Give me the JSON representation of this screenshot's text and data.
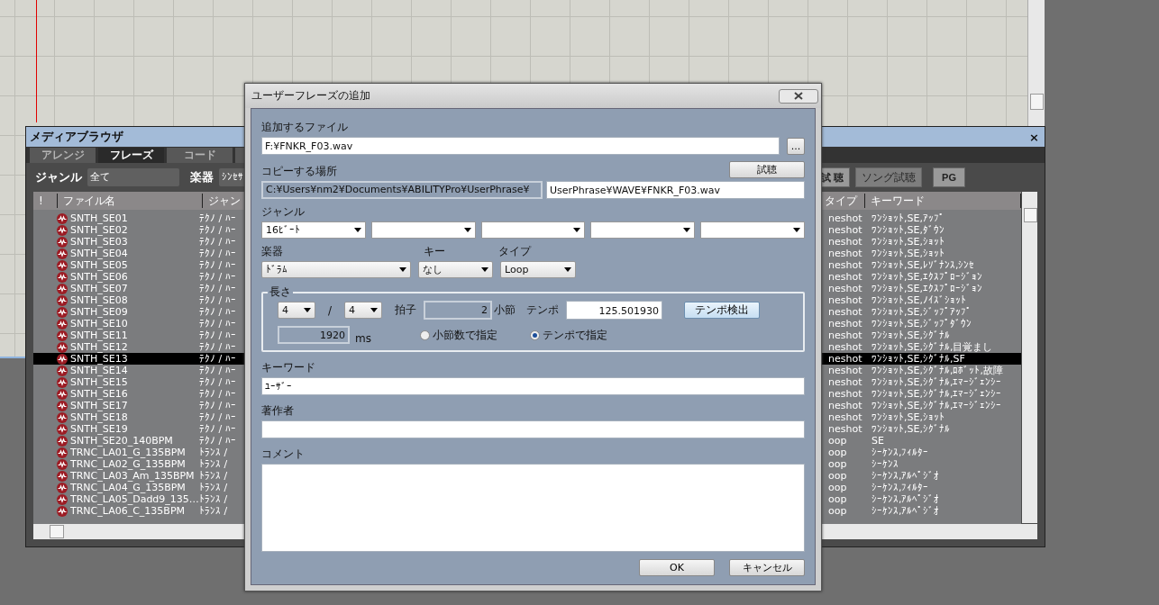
{
  "media_browser": {
    "title": "メディアブラウザ",
    "close": "×",
    "tabs": [
      {
        "label": "アレンジ",
        "selected": false
      },
      {
        "label": "フレーズ",
        "selected": true
      },
      {
        "label": "コード",
        "selected": false
      },
      {
        "selected": false
      }
    ],
    "genre_label": "ジャンル",
    "genre_value": "全て",
    "instrument_label": "楽器",
    "instrument_value": "ｼﾝｾｻ",
    "buttons": [
      {
        "label": "試 聴",
        "disabled": false
      },
      {
        "label": "ソング試聴",
        "disabled": true
      },
      {
        "label": "PG",
        "disabled": false
      }
    ],
    "columns": [
      "!",
      "ファイル名",
      "ジャン",
      "タイプ",
      "キーワード"
    ],
    "rows": [
      {
        "name": "SNTH_SE01",
        "genre": "ﾃｸﾉ / ﾊｰ",
        "type": "neshot",
        "keyword": "ﾜﾝｼｮｯﾄ,SE,ｱｯﾌﾟ",
        "selected": false
      },
      {
        "name": "SNTH_SE02",
        "genre": "ﾃｸﾉ / ﾊｰ",
        "type": "neshot",
        "keyword": "ﾜﾝｼｮｯﾄ,SE,ﾀﾞｳﾝ",
        "selected": false
      },
      {
        "name": "SNTH_SE03",
        "genre": "ﾃｸﾉ / ﾊｰ",
        "type": "neshot",
        "keyword": "ﾜﾝｼｮｯﾄ,SE,ｼｮｯﾄ",
        "selected": false
      },
      {
        "name": "SNTH_SE04",
        "genre": "ﾃｸﾉ / ﾊｰ",
        "type": "neshot",
        "keyword": "ﾜﾝｼｮｯﾄ,SE,ｼｮｯﾄ",
        "selected": false
      },
      {
        "name": "SNTH_SE05",
        "genre": "ﾃｸﾉ / ﾊｰ",
        "type": "neshot",
        "keyword": "ﾜﾝｼｮｯﾄ,SE,ﾚｿﾞﾅﾝｽ,ｼﾝｾ",
        "selected": false
      },
      {
        "name": "SNTH_SE06",
        "genre": "ﾃｸﾉ / ﾊｰ",
        "type": "neshot",
        "keyword": "ﾜﾝｼｮｯﾄ,SE,ｴｸｽﾌﾟﾛｰｼﾞｮﾝ",
        "selected": false
      },
      {
        "name": "SNTH_SE07",
        "genre": "ﾃｸﾉ / ﾊｰ",
        "type": "neshot",
        "keyword": "ﾜﾝｼｮｯﾄ,SE,ｴｸｽﾌﾟﾛｰｼﾞｮﾝ",
        "selected": false
      },
      {
        "name": "SNTH_SE08",
        "genre": "ﾃｸﾉ / ﾊｰ",
        "type": "neshot",
        "keyword": "ﾜﾝｼｮｯﾄ,SE,ﾉｲｽﾞｼｮｯﾄ",
        "selected": false
      },
      {
        "name": "SNTH_SE09",
        "genre": "ﾃｸﾉ / ﾊｰ",
        "type": "neshot",
        "keyword": "ﾜﾝｼｮｯﾄ,SE,ｼﾞｯﾌﾟｱｯﾌﾟ",
        "selected": false
      },
      {
        "name": "SNTH_SE10",
        "genre": "ﾃｸﾉ / ﾊｰ",
        "type": "neshot",
        "keyword": "ﾜﾝｼｮｯﾄ,SE,ｼﾞｯﾌﾟﾀﾞｳﾝ",
        "selected": false
      },
      {
        "name": "SNTH_SE11",
        "genre": "ﾃｸﾉ / ﾊｰ",
        "type": "neshot",
        "keyword": "ﾜﾝｼｮｯﾄ,SE,ｼｸﾞﾅﾙ",
        "selected": false
      },
      {
        "name": "SNTH_SE12",
        "genre": "ﾃｸﾉ / ﾊｰ",
        "type": "neshot",
        "keyword": "ﾜﾝｼｮｯﾄ,SE,ｼｸﾞﾅﾙ,目覚まし",
        "selected": false
      },
      {
        "name": "SNTH_SE13",
        "genre": "ﾃｸﾉ / ﾊｰ",
        "type": "neshot",
        "keyword": "ﾜﾝｼｮｯﾄ,SE,ｼｸﾞﾅﾙ,SF",
        "selected": true
      },
      {
        "name": "SNTH_SE14",
        "genre": "ﾃｸﾉ / ﾊｰ",
        "type": "neshot",
        "keyword": "ﾜﾝｼｮｯﾄ,SE,ｼｸﾞﾅﾙ,ﾛﾎﾞｯﾄ,故障",
        "selected": false
      },
      {
        "name": "SNTH_SE15",
        "genre": "ﾃｸﾉ / ﾊｰ",
        "type": "neshot",
        "keyword": "ﾜﾝｼｮｯﾄ,SE,ｼｸﾞﾅﾙ,ｴﾏｰｼﾞｪﾝｼｰ",
        "selected": false
      },
      {
        "name": "SNTH_SE16",
        "genre": "ﾃｸﾉ / ﾊｰ",
        "type": "neshot",
        "keyword": "ﾜﾝｼｮｯﾄ,SE,ｼｸﾞﾅﾙ,ｴﾏｰｼﾞｪﾝｼｰ",
        "selected": false
      },
      {
        "name": "SNTH_SE17",
        "genre": "ﾃｸﾉ / ﾊｰ",
        "type": "neshot",
        "keyword": "ﾜﾝｼｮｯﾄ,SE,ｼｸﾞﾅﾙ,ｴﾏｰｼﾞｪﾝｼｰ",
        "selected": false
      },
      {
        "name": "SNTH_SE18",
        "genre": "ﾃｸﾉ / ﾊｰ",
        "type": "neshot",
        "keyword": "ﾜﾝｼｮｯﾄ,SE,ｼｮｯﾄ",
        "selected": false
      },
      {
        "name": "SNTH_SE19",
        "genre": "ﾃｸﾉ / ﾊｰ",
        "type": "neshot",
        "keyword": "ﾜﾝｼｮｯﾄ,SE,ｼｸﾞﾅﾙ",
        "selected": false
      },
      {
        "name": "SNTH_SE20_140BPM",
        "genre": "ﾃｸﾉ / ﾊｰ",
        "type": "oop",
        "keyword": "SE",
        "selected": false
      },
      {
        "name": "TRNC_LA01_G_135BPM",
        "genre": "ﾄﾗﾝｽ /",
        "type": "oop",
        "keyword": "ｼｰｹﾝｽ,ﾌｨﾙﾀｰ",
        "selected": false
      },
      {
        "name": "TRNC_LA02_G_135BPM",
        "genre": "ﾄﾗﾝｽ /",
        "type": "oop",
        "keyword": "ｼｰｹﾝｽ",
        "selected": false
      },
      {
        "name": "TRNC_LA03_Am_135BPM",
        "genre": "ﾄﾗﾝｽ /",
        "type": "oop",
        "keyword": "ｼｰｹﾝｽ,ｱﾙﾍﾟｼﾞｵ",
        "selected": false
      },
      {
        "name": "TRNC_LA04_G_135BPM",
        "genre": "ﾄﾗﾝｽ /",
        "type": "oop",
        "keyword": "ｼｰｹﾝｽ,ﾌｨﾙﾀｰ",
        "selected": false
      },
      {
        "name": "TRNC_LA05_Dadd9_135…",
        "genre": "ﾄﾗﾝｽ /",
        "type": "oop",
        "keyword": "ｼｰｹﾝｽ,ｱﾙﾍﾟｼﾞｵ",
        "selected": false
      },
      {
        "name": "TRNC_LA06_C_135BPM",
        "genre": "ﾄﾗﾝｽ /",
        "type": "oop",
        "keyword": "ｼｰｹﾝｽ,ｱﾙﾍﾟｼﾞｵ",
        "selected": false
      }
    ]
  },
  "dialog": {
    "title": "ユーザーフレーズの追加",
    "file_label": "追加するファイル",
    "file_value": "F:¥FNKR_F03.wav",
    "browse": "...",
    "copy_label": "コピーする場所",
    "preview": "試聴",
    "copy_base": "C:¥Users¥nm2¥Documents¥ABILITYPro¥UserPhrase¥",
    "copy_value": "UserPhrase¥WAVE¥FNKR_F03.wav",
    "genre_label": "ジャンル",
    "genres": [
      {
        "kind": "filled",
        "value": "16ﾋﾞｰﾄ"
      },
      {
        "kind": "empty"
      },
      {
        "kind": "empty"
      },
      {
        "kind": "empty"
      },
      {
        "kind": "empty"
      }
    ],
    "instrument_label": "楽器",
    "instrument": "ﾄﾞﾗﾑ",
    "key_label": "キー",
    "key": "なし",
    "type_label": "タイプ",
    "type": "Loop",
    "length": {
      "legend": "長さ",
      "numerator": "4",
      "slash": "/",
      "denominator": "4",
      "beat_label": "拍子",
      "bars": "2",
      "bars_label": "小節",
      "tempo_label": "テンポ",
      "tempo": "125.501930",
      "detect": "テンポ検出",
      "ms": "1920",
      "ms_label": "ms",
      "modes": [
        {
          "label": "小節数で指定",
          "selected": false
        },
        {
          "label": "テンポで指定",
          "selected": true
        }
      ]
    },
    "keyword_label": "キーワード",
    "keyword": "ﾕｰｻﾞｰ",
    "author_label": "著作者",
    "comment_label": "コメント",
    "ok": "OK",
    "cancel": "キャンセル"
  }
}
